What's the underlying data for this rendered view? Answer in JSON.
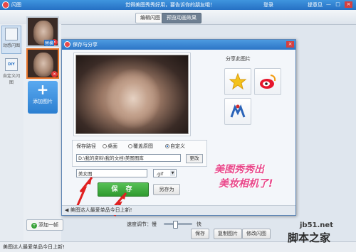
{
  "app": {
    "title": "闪图",
    "banner": "觉得美图秀秀好用，要告诉你的朋友哦！",
    "login": "登录",
    "feedback": "提意见",
    "window_buttons": [
      "—",
      "□",
      "×"
    ]
  },
  "toolbar": {
    "tabs": [
      {
        "label": "编辑闪图",
        "active": false
      },
      {
        "label": "预览动画效果",
        "active": true
      }
    ]
  },
  "leftrail": {
    "items": [
      {
        "label": "动感闪图",
        "icon": "sparkle-icon",
        "active": true
      },
      {
        "label": "自定义闪图",
        "icon": "diy-icon",
        "active": false
      }
    ],
    "diy_icon_text": "DIY"
  },
  "thumbnails": {
    "add_button_label": "添加图片",
    "add_frame_label": "添加一帧",
    "replace_label": "替换",
    "delete_badge": "×"
  },
  "dialog": {
    "title": "保存与分享",
    "close": "×",
    "save_path_label": "保存路径",
    "path_options": [
      {
        "label": "桌面",
        "selected": false
      },
      {
        "label": "覆盖原图",
        "selected": false
      },
      {
        "label": "自定义",
        "selected": true
      }
    ],
    "path_value": "D:\\我的资料\\我的文档\\美图图库",
    "change_button": "更改",
    "filename_value": "美女图",
    "format_value": ".gif",
    "save_button": "保 存",
    "save_as_button": "另存为",
    "share_title": "分享此图片",
    "share_targets": [
      {
        "name": "qzone-icon"
      },
      {
        "name": "weibo-icon"
      },
      {
        "name": "renren-icon"
      }
    ],
    "promo_line1": "美图秀秀出",
    "promo_line2": "美妆相机了!",
    "status_text": "美图达人最爱单品今日上新!"
  },
  "bottom": {
    "speed_label": "速度调节：慢",
    "speed_fast": "快",
    "speed_level": 0.4,
    "buttons": [
      "保存",
      "复制图片",
      "修改闪图"
    ]
  },
  "statusbar": {
    "text": "美图达人最爱单品今日上新!"
  },
  "watermark": {
    "line1": "jb51.net",
    "line2": "脚本之家"
  },
  "colors": {
    "titlebar": "#2c74c6",
    "save_green": "#3aa33a",
    "promo_pink": "#e94a8c",
    "accent_orange": "#e9752b"
  }
}
